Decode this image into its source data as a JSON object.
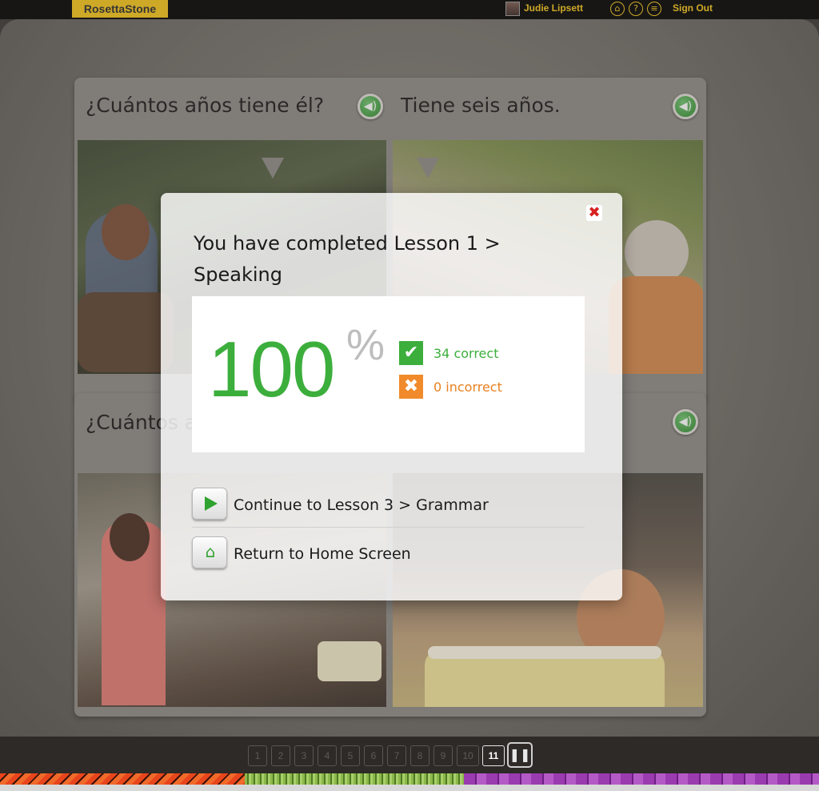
{
  "topbar": {
    "logo": "RosettaStone",
    "user_name": "Judie Lipsett",
    "icons": [
      "home-icon",
      "help-icon",
      "menu-icon"
    ],
    "sign_out": "Sign Out"
  },
  "cards": {
    "top": {
      "left_caption": "¿Cuántos años tiene él?",
      "right_caption": "Tiene seis años."
    },
    "bottom": {
      "left_caption": "¿Cuántos a"
    }
  },
  "dialog": {
    "title": "You have completed Lesson 1 > Speaking",
    "score": "100",
    "percent_symbol": "%",
    "correct_label": "34 correct",
    "incorrect_label": "0 incorrect",
    "continue_label": "Continue to Lesson 3 > Grammar",
    "home_label": "Return to Home Screen"
  },
  "pager": {
    "pages": [
      "1",
      "2",
      "3",
      "4",
      "5",
      "6",
      "7",
      "8",
      "9",
      "10",
      "11"
    ],
    "current": "11"
  },
  "colors": {
    "accent_green": "#3cae3c",
    "warning_orange": "#f08a2a",
    "brand_yellow": "#f5c518",
    "close_red": "#d82020"
  }
}
